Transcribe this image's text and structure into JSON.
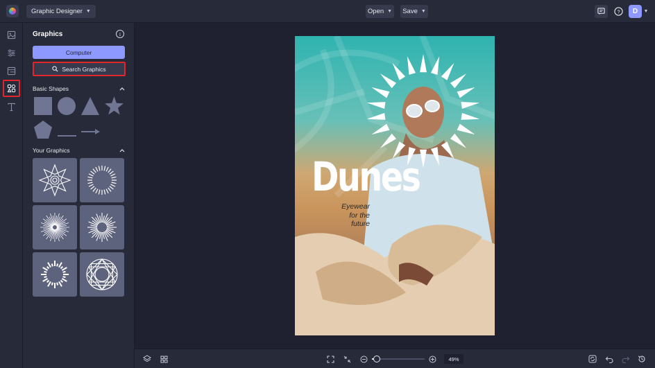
{
  "header": {
    "mode_label": "Graphic Designer",
    "open_label": "Open",
    "save_label": "Save",
    "avatar_initial": "D"
  },
  "panel": {
    "title": "Graphics",
    "computer_label": "Computer",
    "search_label": "Search Graphics",
    "basic_shapes_label": "Basic Shapes",
    "your_graphics_label": "Your Graphics",
    "basic_shapes": [
      "square",
      "circle",
      "triangle",
      "star",
      "pentagon",
      "line",
      "arrow"
    ],
    "your_graphics": [
      "flower-star-icon",
      "sunburst-ring-icon",
      "starburst-lines-icon",
      "starburst-spikes-icon",
      "dashed-sunburst-icon",
      "geometric-circle-icon"
    ]
  },
  "poster": {
    "title": "Dunes",
    "tagline": [
      "Eyewear",
      "for the",
      "future"
    ]
  },
  "footer": {
    "zoom_value": "49%"
  },
  "colors": {
    "accent": "#8e99ff",
    "highlight_border": "#e3262e",
    "panel_bg": "#272a38",
    "canvas_bg": "#1f2130",
    "tile_bg": "#5d627d"
  }
}
